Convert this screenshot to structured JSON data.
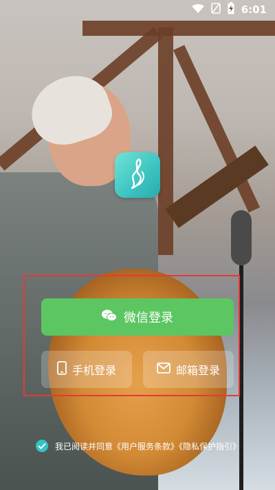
{
  "status_bar": {
    "time": "6:01",
    "icons": [
      "wifi-icon",
      "no-sim-icon",
      "battery-charging-icon"
    ]
  },
  "app": {
    "icon": "guitar-flame-logo-icon",
    "accent": "#3cc3c0"
  },
  "login": {
    "wechat_label": "微信登录",
    "wechat_icon": "wechat-icon",
    "wechat_color": "#5cc662",
    "phone_label": "手机登录",
    "phone_icon": "phone-icon",
    "email_label": "邮箱登录",
    "email_icon": "mail-icon",
    "highlight_color": "#e53935"
  },
  "agreement": {
    "checked": true,
    "text": "我已阅读并同意《用户服务条款》《隐私保护指引》"
  }
}
